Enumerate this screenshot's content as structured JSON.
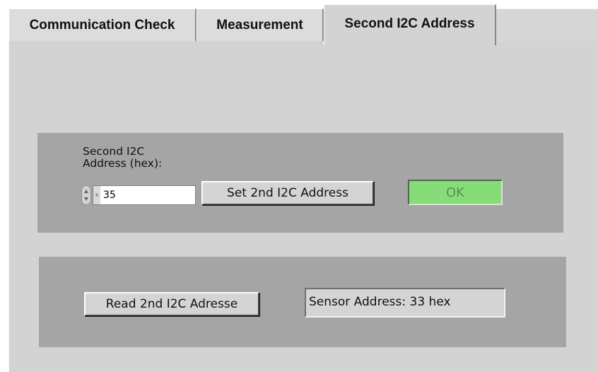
{
  "tabs": [
    {
      "label": "Communication Check",
      "selected": false
    },
    {
      "label": "Measurement",
      "selected": false
    },
    {
      "label": "Second I2C Address",
      "selected": true
    }
  ],
  "set_group": {
    "address_label": "Second I2C\nAddress (hex):",
    "radix": "x",
    "address_value": "35",
    "set_button_label": "Set 2nd I2C Address",
    "status_led_label": "OK",
    "status_led_color": "#86dc78"
  },
  "read_group": {
    "read_button_label": "Read 2nd I2C Adresse",
    "sensor_address_text": "Sensor Address: 33 hex"
  }
}
